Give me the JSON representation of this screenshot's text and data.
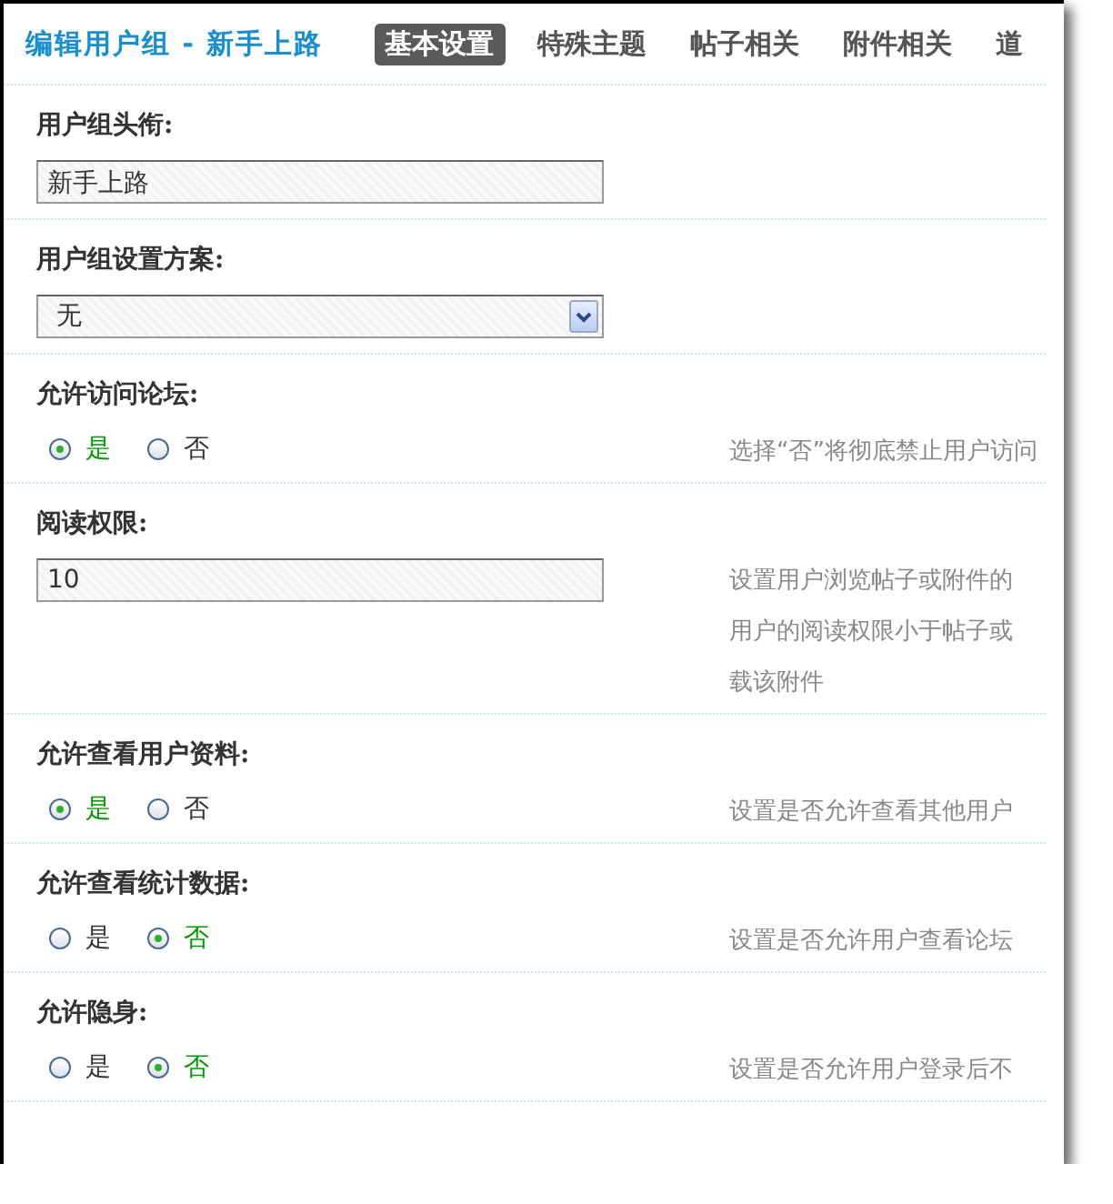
{
  "header": {
    "title": "编辑用户组 - 新手上路"
  },
  "tabs": [
    {
      "label": "基本设置",
      "selected": true
    },
    {
      "label": "特殊主题",
      "selected": false
    },
    {
      "label": "帖子相关",
      "selected": false
    },
    {
      "label": "附件相关",
      "selected": false
    },
    {
      "label": "道",
      "selected": false
    }
  ],
  "settings": [
    {
      "kind": "text",
      "label": "用户组头衔:",
      "value": "新手上路"
    },
    {
      "kind": "select",
      "label": "用户组设置方案:",
      "value": "无"
    },
    {
      "kind": "radio",
      "label": "允许访问论坛:",
      "options": [
        {
          "label": "是",
          "selected": true
        },
        {
          "label": "否",
          "selected": false
        }
      ],
      "hint": [
        "选择“否”将彻底禁止用户访问"
      ]
    },
    {
      "kind": "text",
      "label": "阅读权限:",
      "value": "10",
      "hint": [
        "设置用户浏览帖子或附件的",
        "用户的阅读权限小于帖子或",
        "载该附件"
      ]
    },
    {
      "kind": "radio",
      "label": "允许查看用户资料:",
      "options": [
        {
          "label": "是",
          "selected": true
        },
        {
          "label": "否",
          "selected": false
        }
      ],
      "hint": [
        "设置是否允许查看其他用户"
      ]
    },
    {
      "kind": "radio",
      "label": "允许查看统计数据:",
      "options": [
        {
          "label": "是",
          "selected": false
        },
        {
          "label": "否",
          "selected": true
        }
      ],
      "hint": [
        "设置是否允许用户查看论坛"
      ]
    },
    {
      "kind": "radio",
      "label": "允许隐身:",
      "options": [
        {
          "label": "是",
          "selected": false
        },
        {
          "label": "否",
          "selected": true
        }
      ],
      "hint": [
        "设置是否允许用户登录后不"
      ]
    }
  ]
}
